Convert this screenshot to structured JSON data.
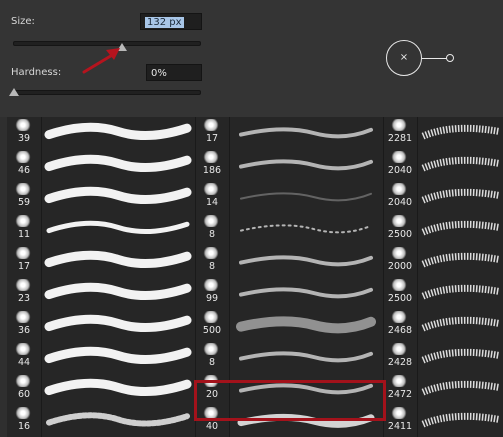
{
  "size": {
    "label": "Size:",
    "value": "132 px"
  },
  "hardness": {
    "label": "Hardness:",
    "value": "0%"
  },
  "preview": {
    "symbol": "×"
  },
  "brushes": {
    "col1": [
      "39",
      "46",
      "59",
      "11",
      "17",
      "23",
      "36",
      "44",
      "60",
      "16"
    ],
    "col2": [
      "17",
      "186",
      "14",
      "8",
      "8",
      "99",
      "500",
      "8",
      "20",
      "40"
    ],
    "col3": [
      "2281",
      "2040",
      "2040",
      "2500",
      "2000",
      "2500",
      "2468",
      "2428",
      "2472",
      "2411"
    ]
  },
  "colors": {
    "highlight": "#a3121b",
    "arrow": "#b5141e",
    "field_selection": "#a8c6e8"
  }
}
